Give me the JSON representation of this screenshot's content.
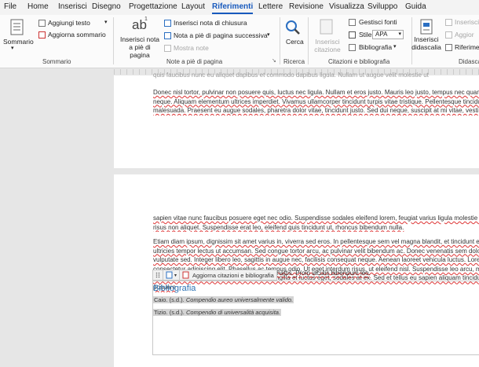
{
  "menu": {
    "tabs": [
      "File",
      "Home",
      "Inserisci",
      "Disegno",
      "Progettazione",
      "Layout",
      "Riferimenti",
      "Lettere",
      "Revisione",
      "Visualizza",
      "Sviluppo",
      "Guida"
    ],
    "active": "Riferimenti"
  },
  "ribbon": {
    "sommario": {
      "big": "Sommario",
      "add_text": "Aggiungi testo",
      "update": "Aggiorna sommario",
      "label": "Sommario"
    },
    "note": {
      "insert_note": "Inserisci nota a piè di pagina",
      "insert_end": "Inserisci nota di chiusura",
      "next_note": "Nota a piè di pagina successiva",
      "show_notes": "Mostra note",
      "label": "Note a piè di pagina",
      "ab_icon": "ab"
    },
    "ricerca": {
      "search": "Cerca",
      "label": "Ricerca"
    },
    "citazioni": {
      "insert_cit": "Inserisci citazione",
      "manage": "Gestisci fonti",
      "style_label": "Stile:",
      "style_value": "APA",
      "biblio": "Bibliografia",
      "label": "Citazioni e bibliografia"
    },
    "didascalie": {
      "insert": "Inserisci didascalia",
      "ins_small": "Inserisci",
      "update_small": "Aggior",
      "riferim": "Riferimen",
      "label": "Didascalie"
    }
  },
  "document": {
    "page1_top": "quis faucibus nunc eu aliquet dapibus et commodo dapibus ligula. Nullam ut augue velit molestie ut",
    "page1_para": [
      "Donec nisl tortor, pulvinar non posuere quis, luctus nec ligula. Nullam et eros justo. Mauris leo justo, tempus nec quam",
      "neque. Aliquam elementum ultrices imperdiet. Vivamus ullamcorper tincidunt turpis vitae tristique. Pellentesque tincidunt",
      "malesuada. Praesent eu augue sodales, pharetra dolor vitae, tincidunt justo. Sed dui neque, suscipit at mi vitae, vestibulum"
    ],
    "page2_para1": [
      "sapien vitae nunc faucibus posuere eget nec odio. Suspendisse sodales eleifend lorem, feugiat varius ligula molestie ut",
      "risus non aliquet. Suspendisse erat leo, eleifend quis tincidunt ut, rhoncus bibendum nulla."
    ],
    "page2_para2": [
      "Etiam diam ipsum, dignissim sit amet varius in, viverra sed eros. In pellentesque sem vel magna blandit, et tincidunt eros",
      "ultricies tempor lectus ut accumsan. Sed congue tortor arcu, ac pulvinar velit bibendum ac. Donec venenatis sem dolor,",
      "vulputate sed. Integer libero leo, sagittis in augue nec, facilisis consequat neque. Aenean laoreet vehicula luctus. Lorem",
      "consectetur adipiscing elit. Phasellus ac tempus odio. Ut eget interdum risus, ut eleifend nisl. Suspendisse leo arcu, maximus",
      "tempus sagittis metus. Donec risus ligula, fringilla et luctus eget, sodales at ex. Sed et tellus eu sapien aliquam tincidunt",
      "posuere"
    ],
    "page2_tail": "id mattis. Proin iaculis bibendum leo."
  },
  "bibliography": {
    "update_button": "Aggiorna citazioni e bibliografia",
    "title": "Bibliografia",
    "entries": [
      {
        "author": "Caio. (s.d.).",
        "work": "Compendio aureo universalmente valido."
      },
      {
        "author": "Tizio. (s.d.).",
        "work": "Compendio di universalità acquisita."
      }
    ]
  },
  "colors": {
    "accent": "#185abd",
    "heading": "#2e74b5"
  }
}
